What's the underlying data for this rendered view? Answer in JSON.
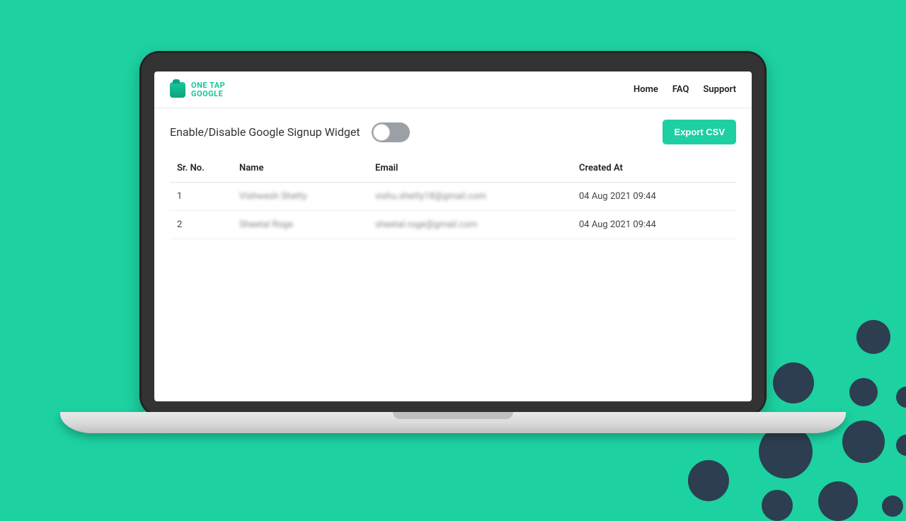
{
  "brand": {
    "line1": "ONE TAP",
    "line2": "GOOGLE"
  },
  "nav": {
    "home": "Home",
    "faq": "FAQ",
    "support": "Support"
  },
  "controls": {
    "toggle_label": "Enable/Disable Google Signup Widget",
    "toggle_state": "off",
    "export_label": "Export CSV"
  },
  "table": {
    "headers": {
      "srno": "Sr. No.",
      "name": "Name",
      "email": "Email",
      "created": "Created At"
    },
    "rows": [
      {
        "n": "1",
        "name": "Vishwesh Shetty",
        "email": "vishu.shetty18@gmail.com",
        "created": "04 Aug 2021 09:44"
      },
      {
        "n": "2",
        "name": "Sheetal Roge",
        "email": "sheetal.roge@gmail.com",
        "created": "04 Aug 2021 09:44"
      }
    ]
  },
  "colors": {
    "accent": "#16c79a",
    "page_bg": "#1dd1a1",
    "dots": "#2c3e50"
  }
}
